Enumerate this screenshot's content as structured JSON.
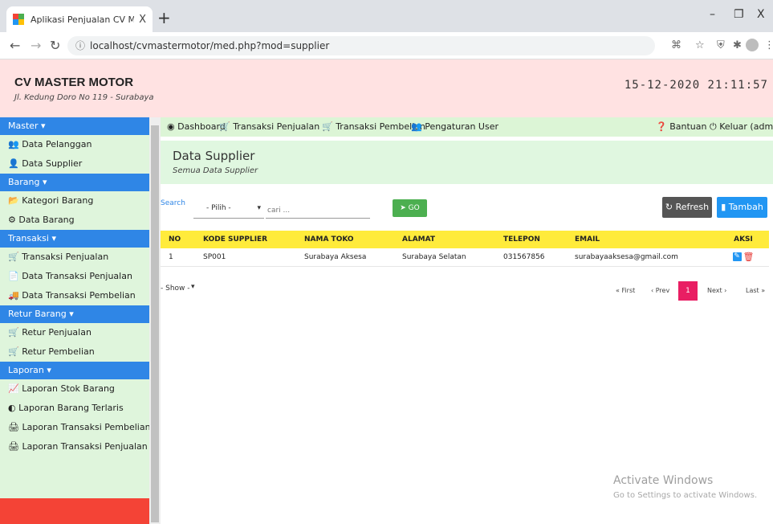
{
  "browser": {
    "tab_title": "Aplikasi Penjualan CV Master Mo",
    "tab_close": "X",
    "new_tab": "+",
    "url": "localhost/cvmastermotor/med.php?mod=supplier",
    "win_min": "–",
    "win_max": "❐",
    "win_close": "X"
  },
  "header": {
    "brand": "CV MASTER MOTOR",
    "address": "Jl. Kedung Doro No 119 - Surabaya",
    "datetime": "15-12-2020 21:11:57",
    "bg_color": "#ffe2e2"
  },
  "sidebar": {
    "sections": [
      {
        "title": "Master ▾",
        "items": [
          {
            "icon": "👥",
            "label": "Data Pelanggan"
          },
          {
            "icon": "👤",
            "label": "Data Supplier"
          }
        ]
      },
      {
        "title": "Barang ▾",
        "items": [
          {
            "icon": "📂",
            "label": "Kategori Barang"
          },
          {
            "icon": "⚙",
            "label": "Data Barang"
          }
        ]
      },
      {
        "title": "Transaksi ▾",
        "items": [
          {
            "icon": "🛒",
            "label": "Transaksi Penjualan"
          },
          {
            "icon": "📄",
            "label": "Data Transaksi Penjualan"
          },
          {
            "icon": "🚚",
            "label": "Data Transaksi Pembelian"
          }
        ]
      },
      {
        "title": "Retur Barang ▾",
        "items": [
          {
            "icon": "🛒",
            "label": "Retur Penjualan"
          },
          {
            "icon": "🛒",
            "label": "Retur Pembelian"
          }
        ]
      },
      {
        "title": "Laporan ▾",
        "items": [
          {
            "icon": "📈",
            "label": "Laporan Stok Barang"
          },
          {
            "icon": "◐",
            "label": "Laporan Barang Terlaris"
          },
          {
            "icon": "🖨",
            "label": "Laporan Transaksi Pembelian"
          },
          {
            "icon": "🖨",
            "label": "Laporan Transaksi Penjualan"
          }
        ]
      }
    ],
    "accent_color": "#2f86e6"
  },
  "topnav": {
    "dashboard": "Dashboard",
    "transaksi_penjualan": "Transaksi Penjualan",
    "transaksi_pembelian": "Transaksi Pembelian",
    "pengaturan_user": "Pengaturan User",
    "bantuan": "Bantuan",
    "keluar": "Keluar (admin)"
  },
  "page": {
    "title": "Data Supplier",
    "subtitle": "Semua Data Supplier"
  },
  "toolbar": {
    "search_label": "Search",
    "pilih_value": "- Pilih -",
    "cari_placeholder": "cari ...",
    "go_label": "GO",
    "refresh_label": "Refresh",
    "tambah_label": "Tambah"
  },
  "table": {
    "headers": [
      "NO",
      "KODE SUPPLIER",
      "NAMA TOKO",
      "ALAMAT",
      "TELEPON",
      "EMAIL",
      "AKSI"
    ],
    "rows": [
      [
        "1",
        "SP001",
        "Surabaya Aksesa",
        "Surabaya Selatan",
        "031567856",
        "surabayaaksesa@gmail.com"
      ]
    ]
  },
  "pagination": {
    "show_value": "- Show -",
    "first": "« First",
    "prev": "‹ Prev",
    "current": "1",
    "next": "Next ›",
    "last": "Last »"
  },
  "watermark": {
    "activate_title": "Activate Windows",
    "activate_sub": "Go to Settings to activate Windows."
  }
}
